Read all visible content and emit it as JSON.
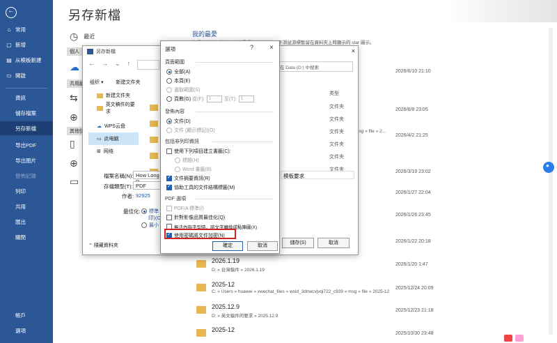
{
  "nav": {
    "items": [
      {
        "label": "常用",
        "icon": "home-icon"
      },
      {
        "label": "新增",
        "icon": "new-doc-icon"
      },
      {
        "label": "从模板新建",
        "icon": "template-icon"
      },
      {
        "label": "開啟",
        "icon": "open-folder-icon"
      }
    ],
    "plain": [
      "資訊",
      "儲存檔案",
      "另存新檔",
      "导出PDF",
      "导出图片",
      "發佈記錄",
      "列印",
      "共用",
      "匯出",
      "關閉"
    ],
    "bottom": [
      "帳戶",
      "選項"
    ]
  },
  "page": {
    "title": "另存新檔"
  },
  "locations": {
    "recent": "最近",
    "personal": "個人",
    "shared": "共用組",
    "other": "其他位"
  },
  "favorites": {
    "title": "我的最愛",
    "desc": "您想要稍後輕鬆找到我的最愛資料夾，按兩下滑鼠游標暫留在資料夾上時顯示的 star 圖示。"
  },
  "rows": [
    {
      "name": "",
      "path": "",
      "date": "2026/6/10 21:10"
    },
    {
      "name": "",
      "path": "",
      "date": "2026/6/8 23:05"
    },
    {
      "name": "",
      "path": "msg » file » 2...",
      "date": "2026/4/2 21:25"
    },
    {
      "name": "",
      "path": "",
      "date": "2026/3/19 23:02"
    },
    {
      "name": "",
      "path": "",
      "date": "2026/1/27 22:04"
    },
    {
      "name": "",
      "path": "",
      "date": "2026/1/26 23:45"
    },
    {
      "name": "",
      "path": "",
      "date": "2026/1/22 20:18"
    },
    {
      "name": "2026.1.19",
      "path": "D: » 台灣稿件 » 2026.1.19",
      "date": "2026/1/20 1:47"
    },
    {
      "name": "2025-12",
      "path": "C: » Users » huawei » xwechat_files » wxid_3drlwcvjvqi722_c939 » msg » file » 2025-12",
      "date": "2025/12/24 20:09"
    },
    {
      "name": "2025.12.9",
      "path": "D: » 英文稿件的要求 » 2025.12.9",
      "date": "2025/12/23 21:18"
    },
    {
      "name": "2025-12",
      "path": "",
      "date": "2025/10/30 23:48"
    }
  ],
  "saveas": {
    "title": "另存新檔",
    "search_placeholder": "在 Data (D:) 中搜索",
    "org": "组织 ▾",
    "newfolder": "新建文件夹",
    "tree": [
      "新建文件夹",
      "英文稿件的要求",
      "WPS云盘",
      "此电脑",
      "网络"
    ],
    "type_header": "类型",
    "types": [
      "文件夹",
      "文件夹",
      "文件夹",
      "文件夹",
      "文件夹",
      "文件夹"
    ],
    "filename_label": "檔案名稱(N):",
    "filename_value": "How Long D",
    "filetype_label": "存檔類型(T):",
    "filetype_value": "PDF",
    "author_label": "作者:",
    "author_value": "92925",
    "max_label": "最佳化:",
    "max_opt1": "標準 (",
    "max_opt1b": "印)(O)",
    "max_opt2": "最小",
    "hide_folders": "隱藏資料夾",
    "tags_partial": "模板要求",
    "save_btn": "儲存(S)",
    "cancel_btn": "取消"
  },
  "opts": {
    "title": "選項",
    "help": "?",
    "close": "×",
    "g1": "頁面範圍",
    "all": "全部(A)",
    "current": "本頁(E)",
    "selection": "選取範圍(S)",
    "pages": "頁數(G)",
    "from": "從(F):",
    "from_val": "1",
    "to": "至(T):",
    "to_val": "1",
    "g2": "發佈內容",
    "doc": "文件(D)",
    "markup": "文件 (顯示標記)(O)",
    "g3": "包括非列印資訊",
    "bookmarks": "使用下列項目建立書籤(C):",
    "headings": "標題(H)",
    "wordbm": "Word 書籤(B)",
    "props": "文件摘要資訊(R)",
    "tags": "協助工具的文件結構標籤(M)",
    "g4": "PDF 選項",
    "pdfa": "PDF/A 標準(/)",
    "optimize": "針對影像品質最佳化(Q)",
    "bitmap": "無法內嵌字型時，將文字轉換成點陣圖(X)",
    "encrypt": "使用密碼將文件加密(N)",
    "ok": "確定",
    "cancel": "取消"
  }
}
